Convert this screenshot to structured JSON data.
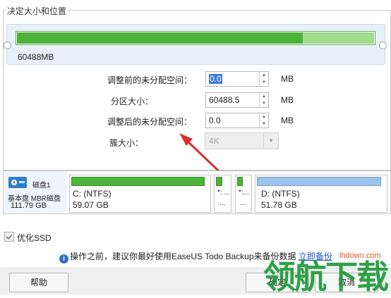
{
  "group": {
    "title": "决定大小和位置"
  },
  "partition_bar": {
    "size_label": "60488MB",
    "used_fraction": 0.8
  },
  "fields": {
    "unallocated_before": {
      "label": "调整前的未分配空间：",
      "value": "0.0",
      "unit": "MB"
    },
    "partition_size": {
      "label": "分区大小：",
      "value": "60488.5",
      "unit": "MB"
    },
    "unallocated_after": {
      "label": "调整后的未分配空间：",
      "value": "0.0",
      "unit": "MB"
    },
    "cluster_size": {
      "label": "簇大小：",
      "value": "4K"
    }
  },
  "disk": {
    "name": "磁盘1",
    "type": "基本盘 MBR磁盘",
    "size": "111.79 GB",
    "partitions": [
      {
        "label": "C: (NTFS)",
        "size": "59.07 GB"
      },
      {
        "label": "*: ...",
        "size": "..."
      },
      {
        "label": "*:...",
        "size": "..."
      },
      {
        "label": "D: (NTFS)",
        "size": "51.78 GB"
      }
    ]
  },
  "ssd_option": {
    "label": "优化SSD",
    "checked": true
  },
  "info": {
    "text": "操作之前，建议你最好使用EaseUS Todo Backup来备份数据",
    "link": "立即备份"
  },
  "buttons": {
    "help": "帮助",
    "ok": "确定",
    "cancel": "取消"
  },
  "watermark": {
    "text": "领航下载",
    "url": "lhdown.com"
  },
  "colors": {
    "accent": "#4cb33a",
    "selection": "#3d7dd8",
    "arrow": "#d9302c",
    "link": "#1a56b8"
  }
}
